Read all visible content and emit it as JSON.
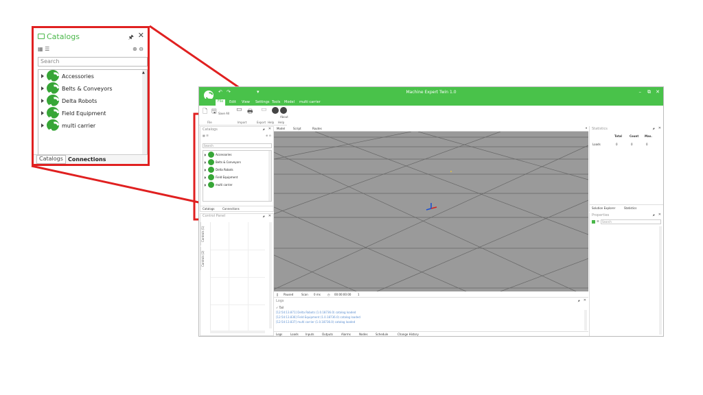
{
  "zoom": {
    "title": "Catalogs",
    "search_placeholder": "Search",
    "items": [
      "Accessories",
      "Belts & Conveyors",
      "Delta Robots",
      "Field Equipment",
      "multi carrier"
    ],
    "tabs": [
      "Catalogs",
      "Connections"
    ]
  },
  "window": {
    "title": "Machine Expert Twin 1.0"
  },
  "menu": [
    "File",
    "Edit",
    "View",
    "Settings",
    "Tools",
    "Model",
    "multi carrier"
  ],
  "ribbon": {
    "save_all": "Save All",
    "about": "About",
    "groups": [
      "File",
      "Import",
      "Export",
      "Help",
      "Help"
    ]
  },
  "catalogs": {
    "title": "Catalogs",
    "search_placeholder": "Search",
    "items": [
      "Accessories",
      "Belts & Conveyors",
      "Delta Robots",
      "Field Equipment",
      "multi carrier"
    ],
    "tabs": [
      "Catalogs",
      "Connections"
    ]
  },
  "control_panel": {
    "title": "Control Panel",
    "vtabs": [
      "Controls (1)",
      "Controls (2)"
    ]
  },
  "viewport": {
    "tabs": [
      "Model",
      "Script",
      "Routes"
    ]
  },
  "status": {
    "state": "Paused",
    "scan_label": "Scan",
    "scan_value": "0 ms",
    "time": "00:00:00:00",
    "speed": "1"
  },
  "logs": {
    "title": "Logs",
    "tail": "Tail",
    "lines": [
      "[12:54:13.871] Delta Robots (1.0.18736.0) catalog loaded",
      "[12:54:13.836] Field Equipment (1.0.18736.0) catalog loaded",
      "[12:54:13.837] multi carrier (1.0.18736.0) catalog loaded"
    ],
    "tabs": [
      "Logs",
      "Loads",
      "Inputs",
      "Outputs",
      "Alarms",
      "Nodes",
      "Schedule",
      "Change History"
    ]
  },
  "statistics": {
    "title": "Statistics",
    "headers": [
      "Total",
      "Count",
      "Max."
    ],
    "row_label": "Loads",
    "row_values": [
      "0",
      "0",
      "0"
    ],
    "tabs": [
      "Solution Explorer",
      "Statistics"
    ]
  },
  "properties": {
    "title": "Properties",
    "search_placeholder": "Search"
  },
  "colors": {
    "accent": "#49c24a",
    "callout": "#e02020"
  }
}
